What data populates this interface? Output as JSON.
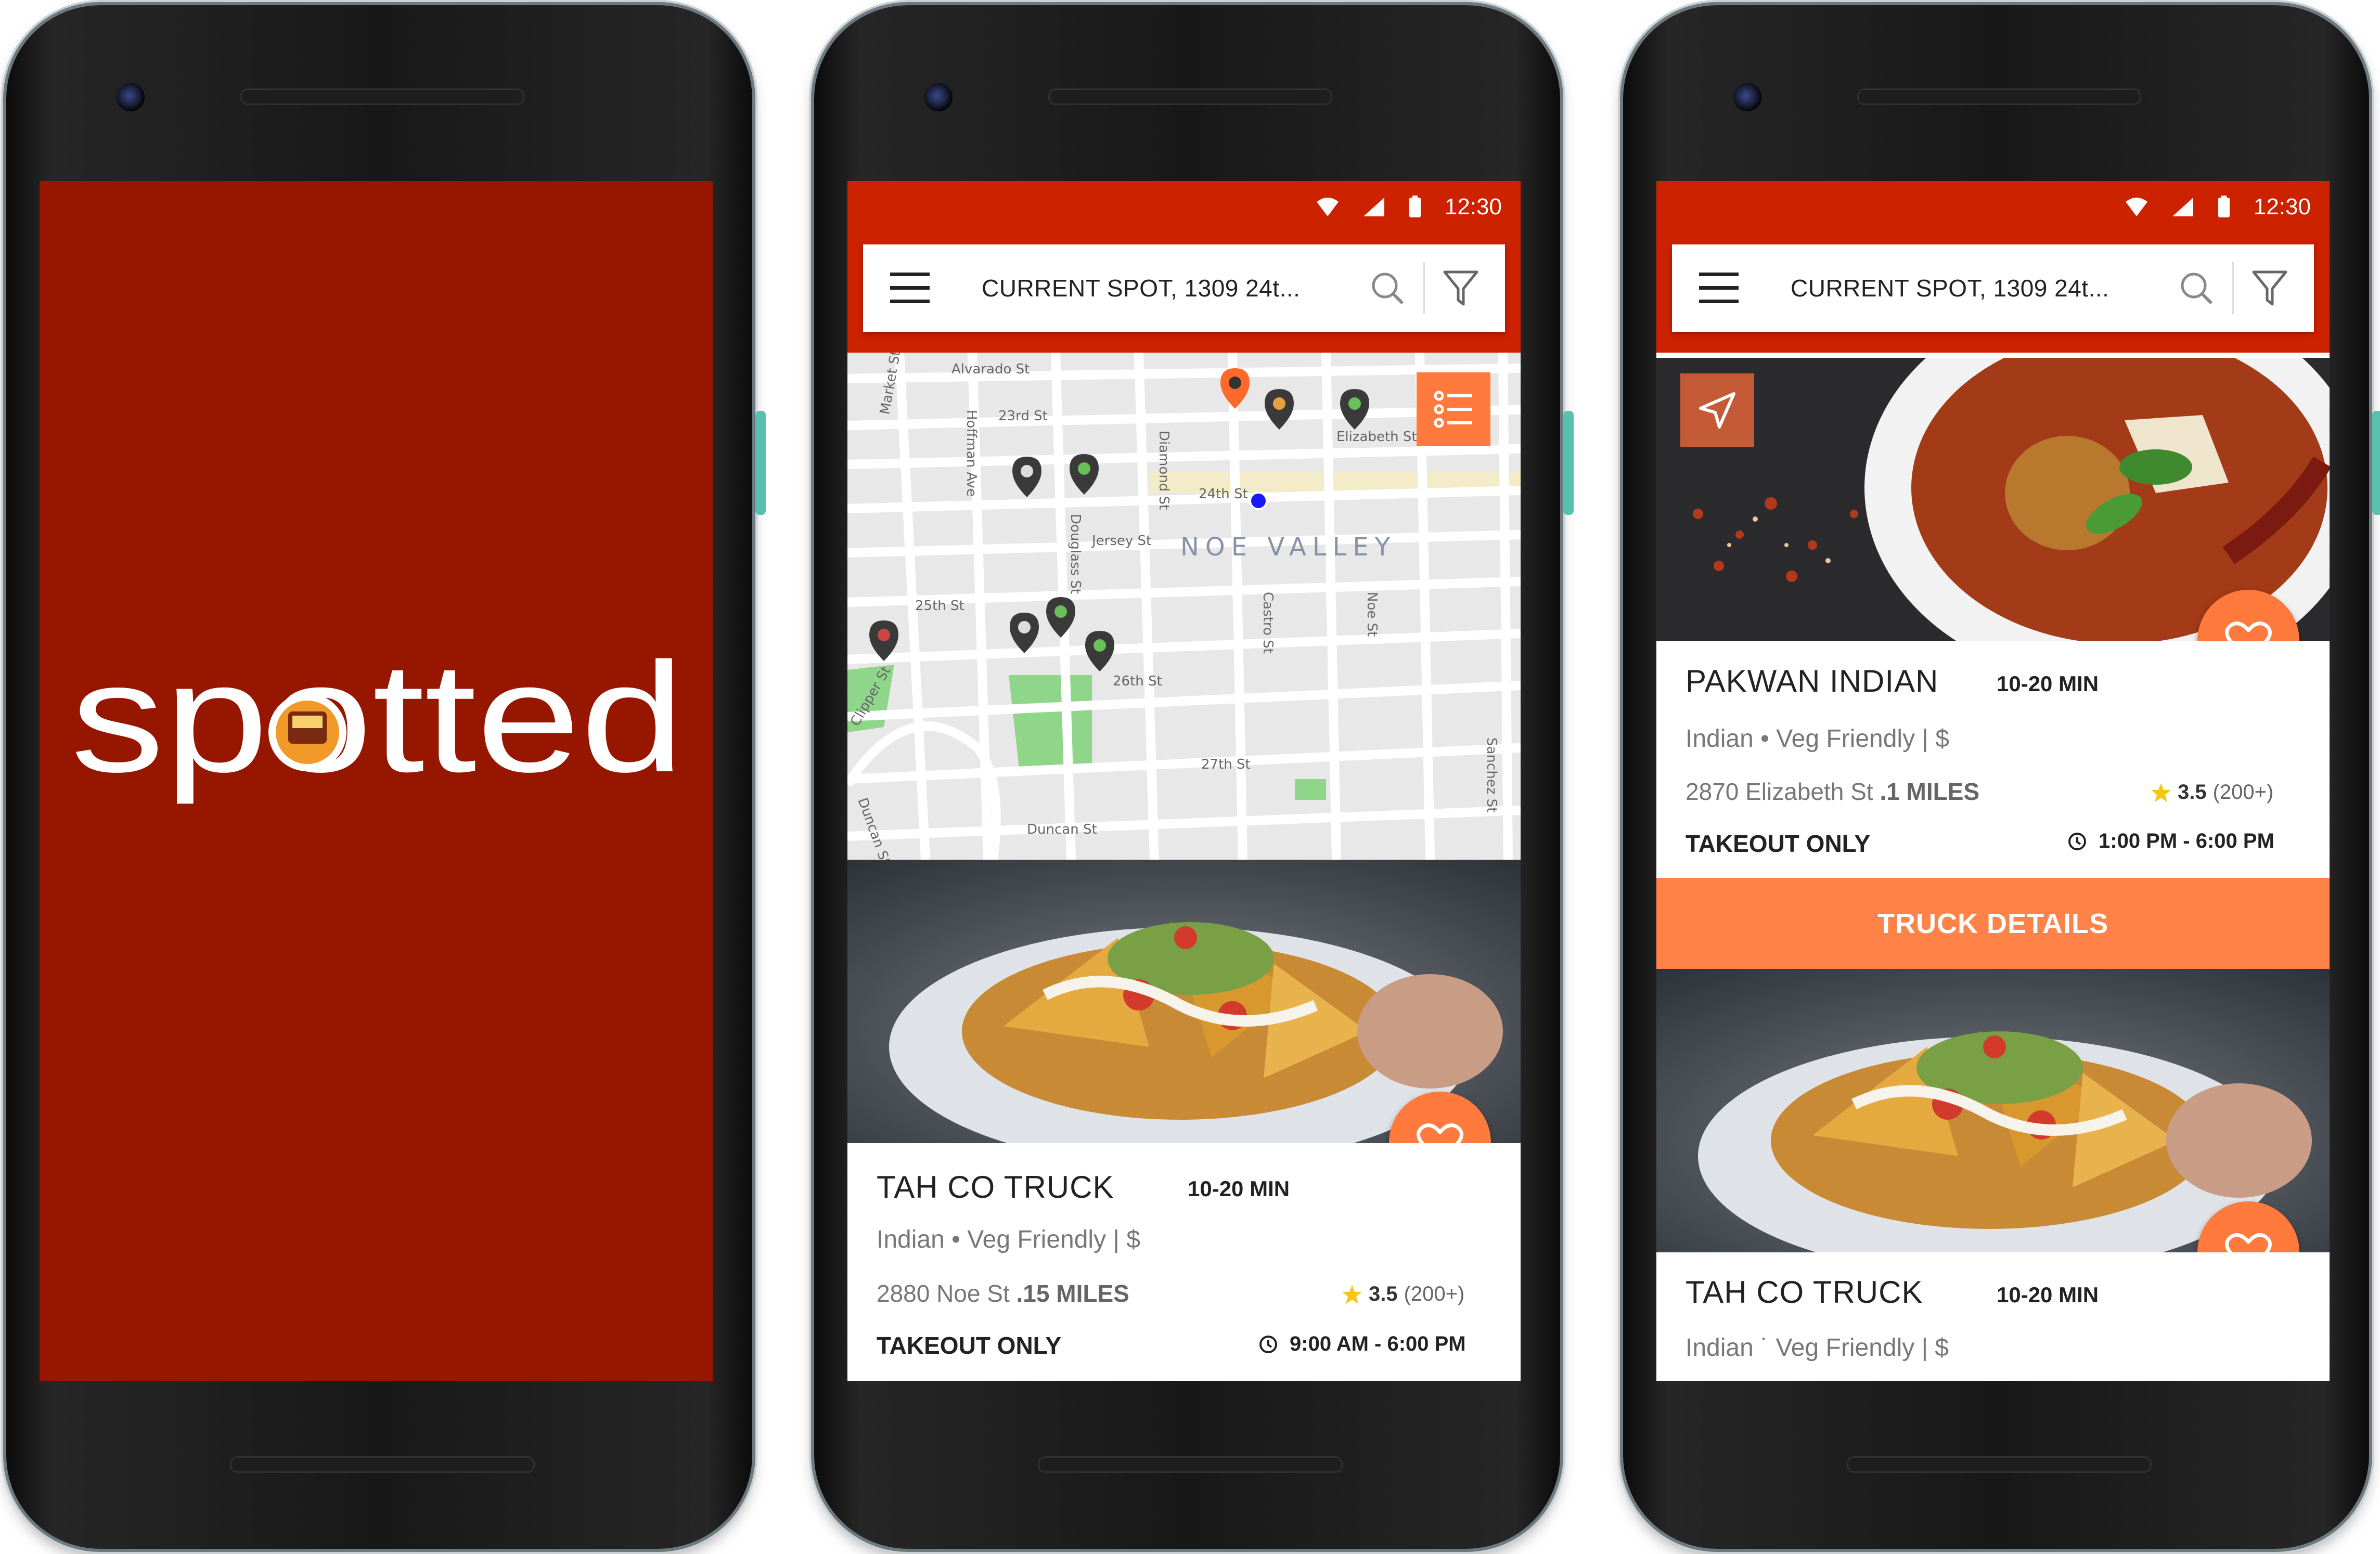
{
  "splash": {
    "logo_text": "spotted"
  },
  "status": {
    "time": "12:30"
  },
  "search": {
    "current_spot": "CURRENT SPOT, 1309 24t..."
  },
  "map": {
    "neighborhood": "NOE VALLEY",
    "streets": [
      "Alvarado St",
      "23rd St",
      "Elizabeth St",
      "24th St",
      "Jersey St",
      "25th St",
      "26th St",
      "27th St",
      "Duncan St",
      "Market St",
      "Hoffman Ave",
      "Douglass St",
      "Diamond St",
      "Castro St",
      "Noe St",
      "Sanchez St",
      "Clipper St",
      "Duncan St"
    ]
  },
  "screen2": {
    "card": {
      "name": "TAH CO TRUCK",
      "time": "10-20 MIN",
      "cats": "Indian • Veg Friendly  |  $",
      "address": "2880 Noe St",
      "miles": ".15 MILES",
      "rating": "3.5",
      "count": "(200+)",
      "takeout": "TAKEOUT ONLY",
      "hours": "9:00 AM - 6:00 PM"
    }
  },
  "screen3": {
    "card1": {
      "name": "PAKWAN INDIAN",
      "time": "10-20 MIN",
      "cats": "Indian • Veg Friendly  |  $",
      "address": "2870 Elizabeth St",
      "miles": ".1 MILES",
      "rating": "3.5",
      "count": "(200+)",
      "takeout": "TAKEOUT ONLY",
      "hours": "1:00 PM - 6:00 PM"
    },
    "details_button": "TRUCK DETAILS",
    "card2": {
      "name": "TAH CO TRUCK",
      "time": "10-20 MIN",
      "cats": "Indian ˙ Veg Friendly  |  $"
    }
  },
  "colors": {
    "splash_bg": "#961600",
    "status_red": "#cc2200",
    "accent_orange": "#ff7a3c"
  },
  "icons": [
    "menu-icon",
    "search-icon",
    "filter-icon",
    "list-icon",
    "heart-icon",
    "navigate-icon",
    "star-icon",
    "clock-icon",
    "wifi-icon",
    "signal-icon",
    "battery-icon",
    "map-pin-icon"
  ]
}
